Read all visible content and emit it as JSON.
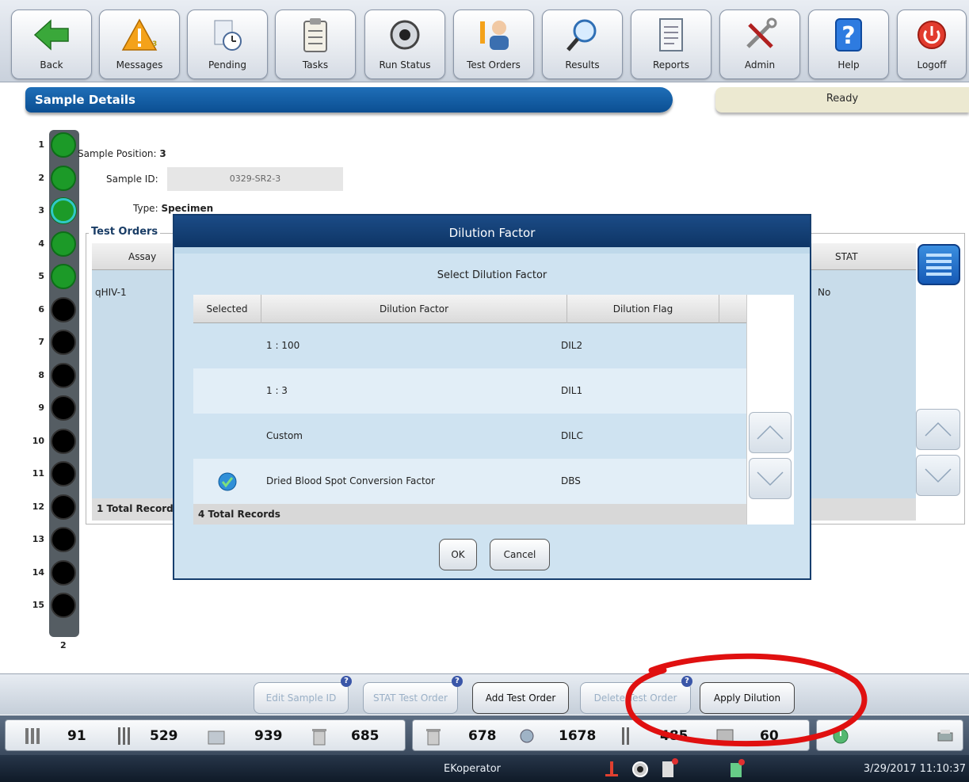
{
  "toolbar": {
    "buttons": [
      {
        "label": "Back",
        "icon": "back-arrow-icon"
      },
      {
        "label": "Messages",
        "icon": "warning-icon",
        "badge": "3"
      },
      {
        "label": "Pending",
        "icon": "pending-clock-icon"
      },
      {
        "label": "Tasks",
        "icon": "clipboard-icon"
      },
      {
        "label": "Run Status",
        "icon": "run-status-icon"
      },
      {
        "label": "Test Orders",
        "icon": "test-orders-icon"
      },
      {
        "label": "Results",
        "icon": "magnifier-icon"
      },
      {
        "label": "Reports",
        "icon": "report-icon"
      },
      {
        "label": "Admin",
        "icon": "tools-icon"
      },
      {
        "label": "Help",
        "icon": "help-icon"
      },
      {
        "label": "Logoff",
        "icon": "power-icon"
      }
    ]
  },
  "header": {
    "title": "Sample Details",
    "status": "Ready"
  },
  "rack": {
    "positions": [
      "1",
      "2",
      "3",
      "4",
      "5",
      "6",
      "7",
      "8",
      "9",
      "10",
      "11",
      "12",
      "13",
      "14",
      "15"
    ],
    "states": [
      "green",
      "green",
      "selected",
      "green",
      "green",
      "black",
      "black",
      "black",
      "black",
      "black",
      "black",
      "black",
      "black",
      "black",
      "black"
    ],
    "footer": "2"
  },
  "sample": {
    "position_label": "Sample Position:",
    "position_value": "3",
    "id_label": "Sample ID:",
    "id_value": "0329-SR2-3",
    "type_label": "Type:",
    "type_value": "Specimen"
  },
  "test_orders": {
    "group_title": "Test Orders",
    "col_assay": "Assay",
    "col_stat": "STAT",
    "rows": [
      {
        "assay": "qHIV-1",
        "stat": "No"
      }
    ],
    "footer": "1 Total Records"
  },
  "dialog": {
    "title": "Dilution Factor",
    "subtitle": "Select Dilution Factor",
    "columns": [
      "Selected",
      "Dilution Factor",
      "Dilution Flag"
    ],
    "rows": [
      {
        "selected": false,
        "factor": "1 : 100",
        "flag": "DIL2"
      },
      {
        "selected": false,
        "factor": "1 : 3",
        "flag": "DIL1"
      },
      {
        "selected": false,
        "factor": "Custom",
        "flag": "DILC"
      },
      {
        "selected": true,
        "factor": "Dried Blood Spot Conversion Factor",
        "flag": "DBS"
      }
    ],
    "footer": "4 Total Records",
    "ok": "OK",
    "cancel": "Cancel"
  },
  "actions": {
    "edit_sample_id": "Edit Sample ID",
    "stat_test_order": "STAT Test Order",
    "add_test_order": "Add Test Order",
    "delete_test_order": "Delete Test Order",
    "apply_dilution": "Apply Dilution"
  },
  "counters": [
    "91",
    "529",
    "939",
    "685",
    "678",
    "1678",
    "485",
    "60"
  ],
  "status_bar": {
    "user": "EKoperator",
    "datetime": "3/29/2017 11:10:37"
  },
  "colors": {
    "accent": "#0b4f92",
    "tube_green": "#1c9a28",
    "annotation": "#e01010"
  }
}
